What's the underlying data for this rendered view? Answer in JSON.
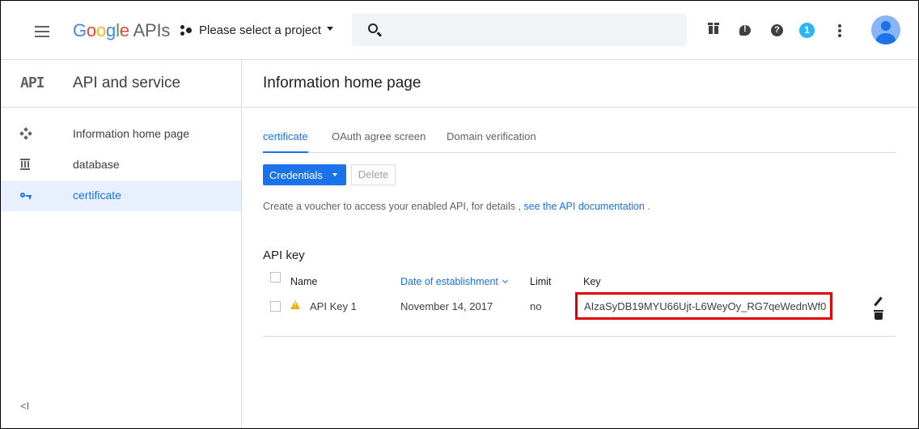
{
  "header": {
    "logo_google": "Google",
    "logo_apis": " APIs",
    "project_label": "Please select a project",
    "notification_count": "1"
  },
  "sidebar": {
    "logo": "API",
    "title": "API and service",
    "items": [
      {
        "label": "Information home page",
        "icon": "dashboard-icon",
        "active": false
      },
      {
        "label": "database",
        "icon": "library-icon",
        "active": false
      },
      {
        "label": "certificate",
        "icon": "key-icon",
        "active": true
      }
    ],
    "collapse_label": "<I"
  },
  "main": {
    "title": "Information home page",
    "tabs": [
      {
        "label": "certificate",
        "active": true
      },
      {
        "label": "OAuth agree screen",
        "active": false
      },
      {
        "label": "Domain verification",
        "active": false
      }
    ],
    "credentials_button": "Credentials",
    "delete_button": "Delete",
    "description_text": "Create a voucher to access your enabled API, for details ,",
    "description_link": "see the API documentation",
    "description_end": ".",
    "section_title": "API key",
    "table": {
      "columns": [
        "Name",
        "Date of establishment",
        "Limit",
        "Key"
      ],
      "rows": [
        {
          "name": "API Key 1",
          "date": "November 14, 2017",
          "limit": "no",
          "key": "AIzaSyDB19MYU66Ujt-L6WeyOy_RG7qeWednWf0"
        }
      ]
    }
  },
  "colors": {
    "accent": "#1a73e8",
    "active_bg": "#e8f0fe",
    "warning": "#f9ab00",
    "highlight_box": "#e00000"
  }
}
